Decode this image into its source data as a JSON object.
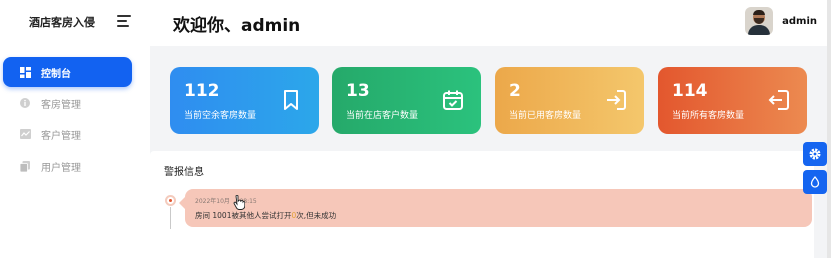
{
  "sidebar": {
    "brand": "酒店客房入侵",
    "items": [
      {
        "label": "控制台",
        "icon": "dashboard-icon",
        "active": true
      },
      {
        "label": "客房管理",
        "icon": "info-icon",
        "active": false
      },
      {
        "label": "客户管理",
        "icon": "chart-icon",
        "active": false
      },
      {
        "label": "用户管理",
        "icon": "copy-icon",
        "active": false
      }
    ]
  },
  "header": {
    "welcome": "欢迎你、admin",
    "username": "admin"
  },
  "stats": [
    {
      "value": "112",
      "label": "当前空余客房数量",
      "icon": "bookmark-icon"
    },
    {
      "value": "13",
      "label": "当前在店客户数量",
      "icon": "calendar-check-icon"
    },
    {
      "value": "2",
      "label": "当前已用客房数量",
      "icon": "login-icon"
    },
    {
      "value": "114",
      "label": "当前所有客房数量",
      "icon": "logout-icon"
    }
  ],
  "alerts": {
    "title": "警报信息",
    "items": [
      {
        "time": "2022年10月",
        "time_rest": "08:15",
        "msg_prefix": "房间 1001被其他人尝试打开",
        "count": "0",
        "msg_suffix": "次,但未成功"
      }
    ]
  },
  "colors": {
    "primary": "#1262f1",
    "card_blue": "#2f8df0",
    "card_green": "#25a96a",
    "card_orange": "#eca84a",
    "card_red": "#e3572e",
    "alert_bg": "#f6c7b9"
  }
}
